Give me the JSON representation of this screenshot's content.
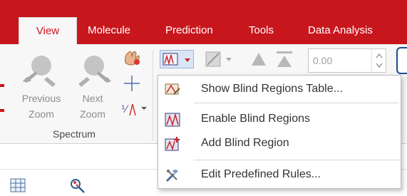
{
  "tabs": [
    {
      "label": "View",
      "active": true
    },
    {
      "label": "Molecule"
    },
    {
      "label": "Prediction"
    },
    {
      "label": "Tools"
    },
    {
      "label": "Data Analysis"
    }
  ],
  "spectrum_group": {
    "previous": {
      "line1": "Previous",
      "line2": "Zoom"
    },
    "next": {
      "line1": "Next",
      "line2": "Zoom"
    },
    "label": "Spectrum"
  },
  "threshold_value": "0.00",
  "blind_menu": {
    "items": [
      {
        "label": "Show Blind Regions Table...",
        "icon": "blind-table-icon"
      },
      {
        "label": "Enable Blind Regions",
        "icon": "blind-regions-icon"
      },
      {
        "label": "Add Blind Region",
        "icon": "add-blind-region-icon"
      },
      {
        "label": "Edit Predefined Rules...",
        "icon": "tools-icon"
      }
    ]
  },
  "colors": {
    "accent": "#c8161d",
    "ribbon_bg": "#f7f7f7"
  }
}
